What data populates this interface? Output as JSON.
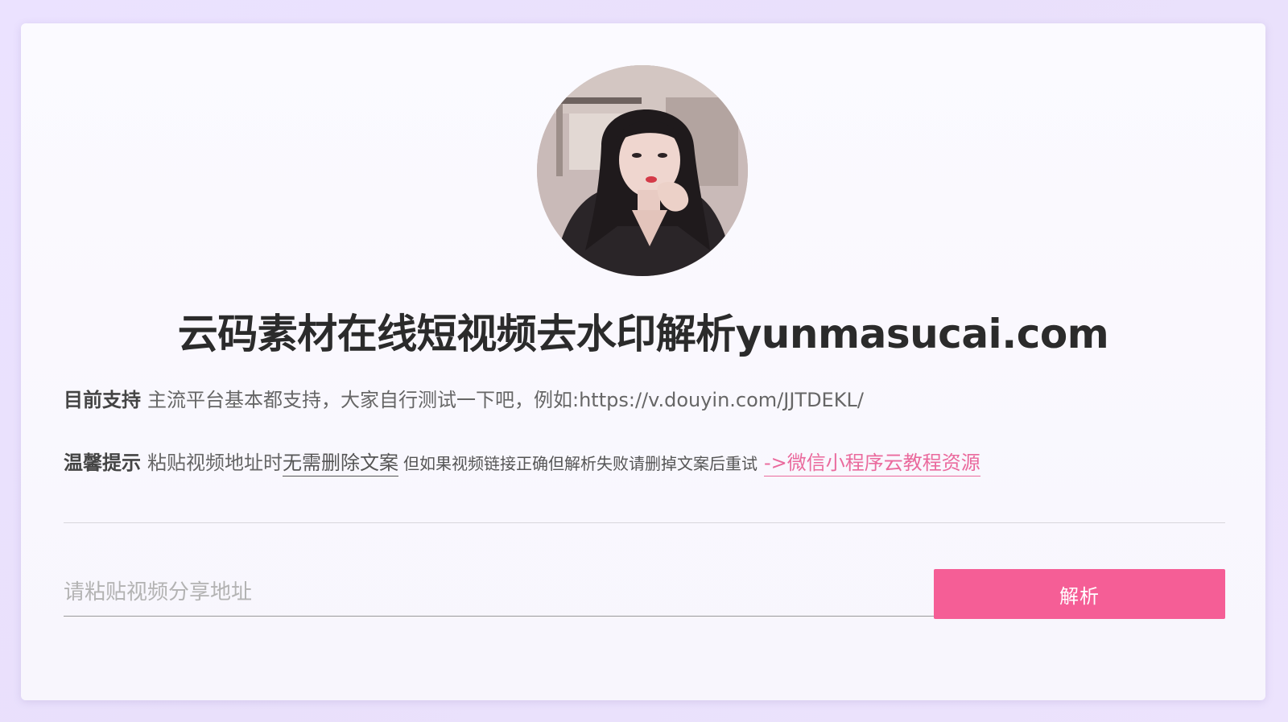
{
  "header": {
    "title": "云码素材在线短视频去水印解析yunmasucai.com"
  },
  "info": {
    "support": {
      "label": "目前支持",
      "text": "主流平台基本都支持，大家自行测试一下吧，例如:https://v.douyin.com/JJTDEKL/"
    },
    "tip": {
      "label": "温馨提示",
      "text_before": "粘贴视频地址时",
      "underlined": "无需删除文案",
      "small_note": "但如果视频链接正确但解析失败请删掉文案后重试",
      "link": "->微信小程序云教程资源"
    }
  },
  "form": {
    "input_placeholder": "请粘贴视频分享地址",
    "input_value": "",
    "button_label": "解析"
  },
  "colors": {
    "accent": "#f55e96",
    "link": "#ea6a9d",
    "background": "#ebe2ff"
  }
}
